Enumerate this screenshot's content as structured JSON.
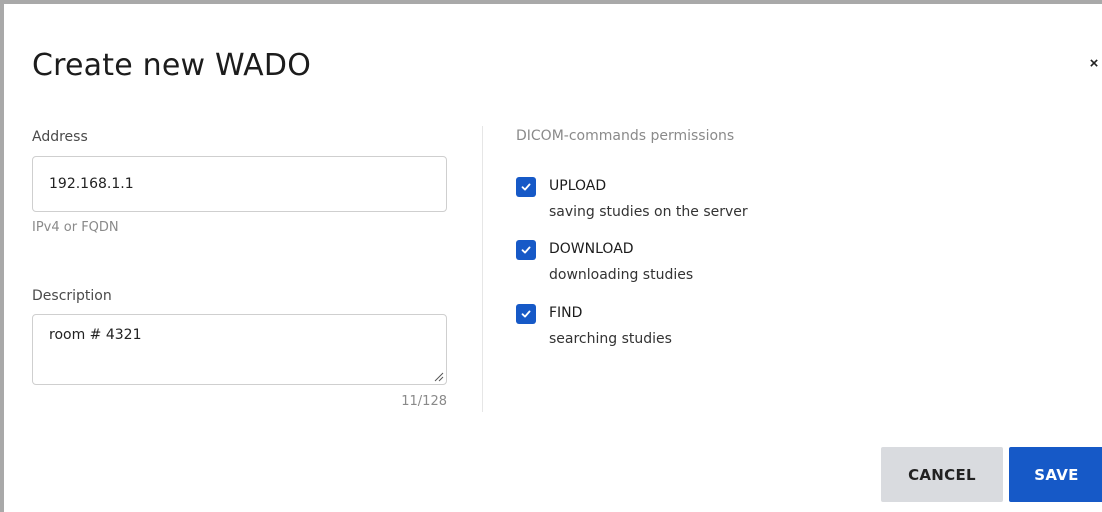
{
  "dialog": {
    "title": "Create new WADO",
    "close_label": "×"
  },
  "form": {
    "address": {
      "label": "Address",
      "value": "192.168.1.1",
      "helper": "IPv4 or FQDN"
    },
    "description": {
      "label": "Description",
      "value": "room # 4321",
      "counter": "11/128"
    }
  },
  "permissions": {
    "heading": "DICOM-commands permissions",
    "items": [
      {
        "name": "UPLOAD",
        "description": "saving studies on the server",
        "checked": true
      },
      {
        "name": "DOWNLOAD",
        "description": "downloading studies",
        "checked": true
      },
      {
        "name": "FIND",
        "description": "searching studies",
        "checked": true
      }
    ]
  },
  "actions": {
    "cancel_label": "CANCEL",
    "save_label": "SAVE"
  },
  "colors": {
    "accent": "#1659c7",
    "cancel_bg": "#d9dbdf",
    "frame_border": "#a9a9a9"
  },
  "icons": {
    "close": "close-icon",
    "check": "checkmark-icon",
    "resize": "resize-handle-icon"
  }
}
